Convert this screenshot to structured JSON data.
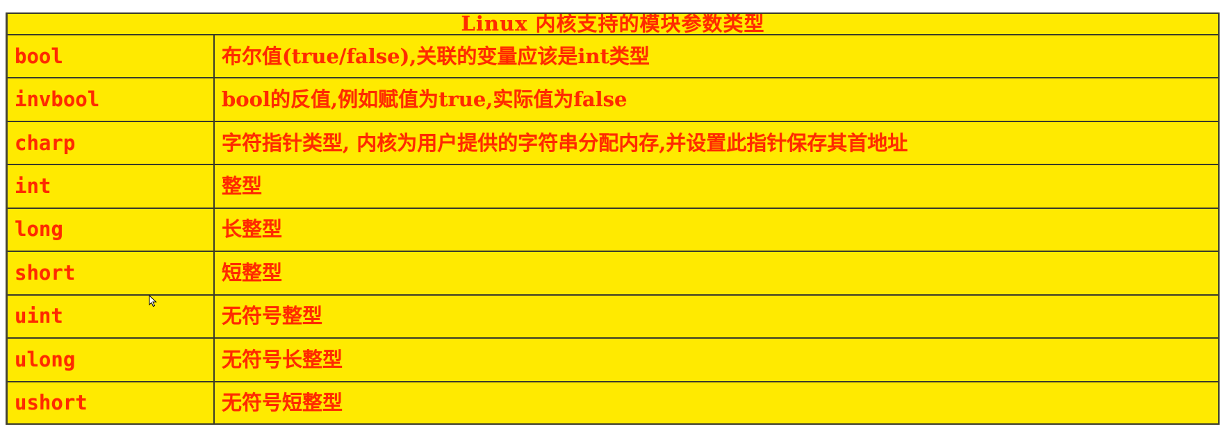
{
  "table": {
    "title": "Linux 内核支持的模块参数类型",
    "rows": [
      {
        "type": "bool",
        "desc": "布尔值(true/false),关联的变量应该是int类型"
      },
      {
        "type": "invbool",
        "desc": "bool的反值,例如赋值为true,实际值为false"
      },
      {
        "type": "charp",
        "desc": "字符指针类型, 内核为用户提供的字符串分配内存,并设置此指针保存其首地址"
      },
      {
        "type": "int",
        "desc": "整型"
      },
      {
        "type": "long",
        "desc": "长整型"
      },
      {
        "type": "short",
        "desc": "短整型"
      },
      {
        "type": "uint",
        "desc": "无符号整型"
      },
      {
        "type": "ulong",
        "desc": "无符号长整型"
      },
      {
        "type": "ushort",
        "desc": "无符号短整型"
      }
    ]
  },
  "colors": {
    "background": "#ffea00",
    "text": "#ff2a00",
    "border": "#3a3a2a"
  },
  "icons": {
    "cursor": "mouse-pointer-icon"
  }
}
